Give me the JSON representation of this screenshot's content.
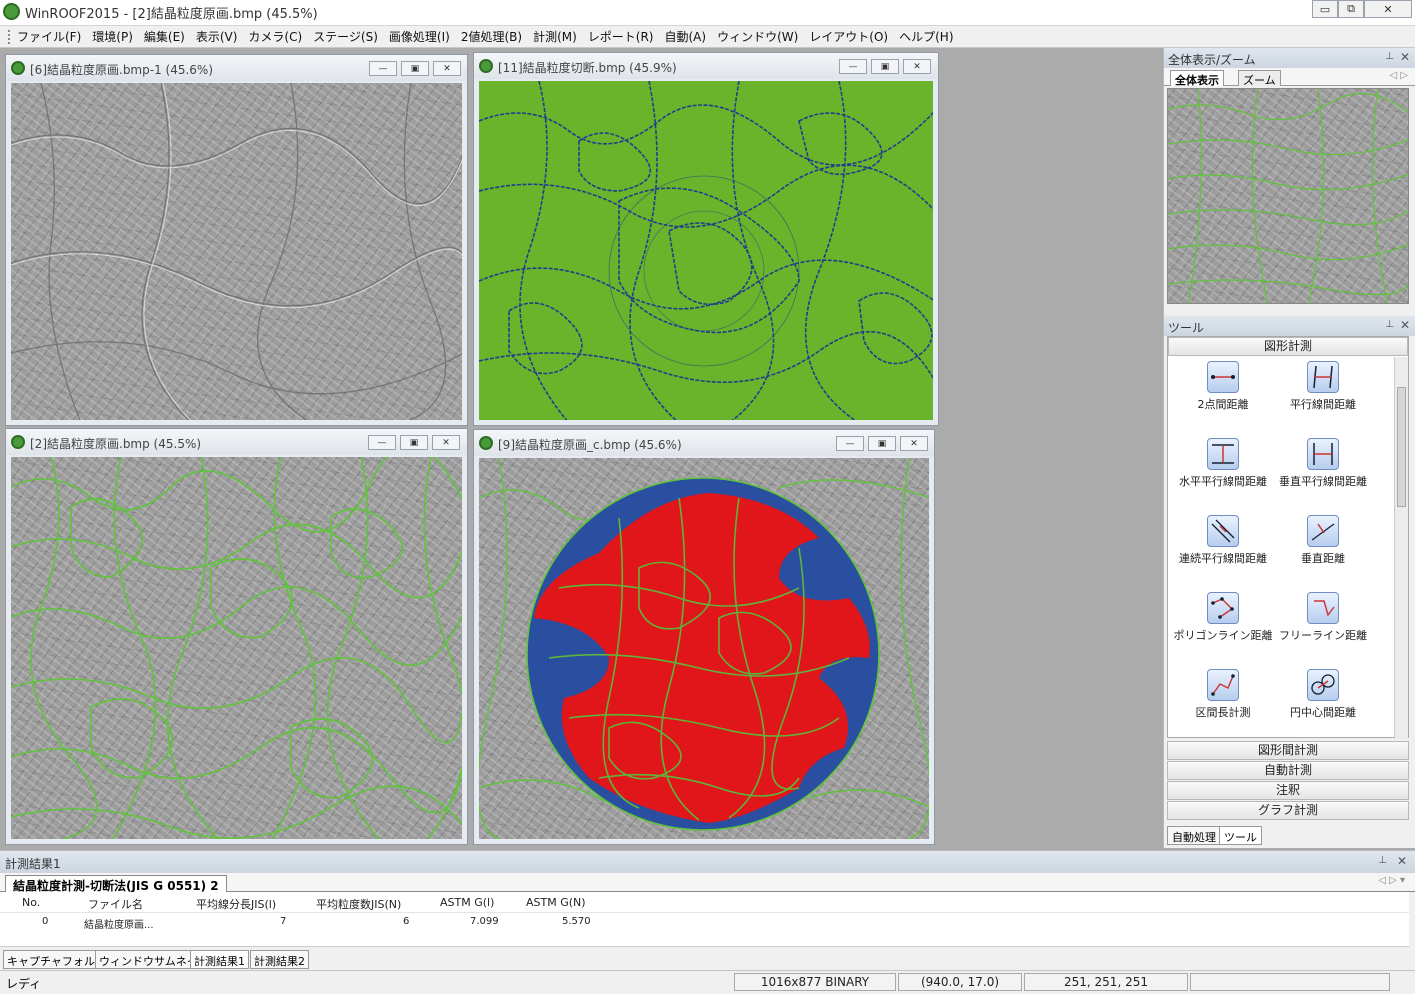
{
  "app": {
    "title": "WinROOF2015 - [2]結晶粒度原画.bmp (45.5%)"
  },
  "window_controls": {
    "minimize": "▭",
    "restore": "⧉",
    "close": "✕"
  },
  "menu": [
    "ファイル(F)",
    "環境(P)",
    "編集(E)",
    "表示(V)",
    "カメラ(C)",
    "ステージ(S)",
    "画像処理(I)",
    "2値処理(B)",
    "計測(M)",
    "レポート(R)",
    "自動(A)",
    "ウィンドウ(W)",
    "レイアウト(O)",
    "ヘルプ(H)"
  ],
  "children": [
    {
      "title": "[6]結晶粒度原画.bmp-1 (45.6%)"
    },
    {
      "title": "[11]結晶粒度切断.bmp (45.9%)"
    },
    {
      "title": "[2]結晶粒度原画.bmp (45.5%)"
    },
    {
      "title": "[9]結晶粒度原画_c.bmp (45.6%)"
    }
  ],
  "overview_panel": {
    "title": "全体表示/ズーム",
    "tabs": [
      "全体表示",
      "ズーム"
    ]
  },
  "tools_panel": {
    "title": "ツール",
    "group_open": "図形計測",
    "tools": [
      "2点間距離",
      "平行線間距離",
      "水平平行線間距離",
      "垂直平行線間距離",
      "連続平行線間距離",
      "垂直距離",
      "ポリゴンライン距離",
      "フリーライン距離",
      "区間長計測",
      "円中心間距離"
    ],
    "groups_closed": [
      "図形間計測",
      "自動計測",
      "注釈",
      "グラフ計測"
    ],
    "bottom_tabs": [
      "自動処理",
      "ツール"
    ]
  },
  "results": {
    "panel_title": "計測結果1",
    "tab": "結晶粒度計測-切断法(JIS G 0551) 2",
    "columns": [
      "No.",
      "ファイル名",
      "平均線分長JIS(l)",
      "平均粒度数JIS(N)",
      "ASTM G(l)",
      "ASTM G(N)"
    ],
    "row": [
      "0",
      "結晶粒度原画...",
      "7",
      "6",
      "7.099",
      "5.570"
    ],
    "bottom_tabs": [
      "キャプチャフォルダー",
      "ウィンドウサムネイル",
      "計測結果1",
      "計測結果2"
    ]
  },
  "status": {
    "ready": "レディ",
    "image_info": "1016x877 BINARY",
    "coords": "(940.0, 17.0)",
    "rgb": "251, 251, 251"
  },
  "colors": {
    "grain_boundary": "#5fc43a",
    "green_bg": "#6ab42b",
    "circle_blue": "#2a4fa0",
    "red_region": "#e0161b"
  }
}
